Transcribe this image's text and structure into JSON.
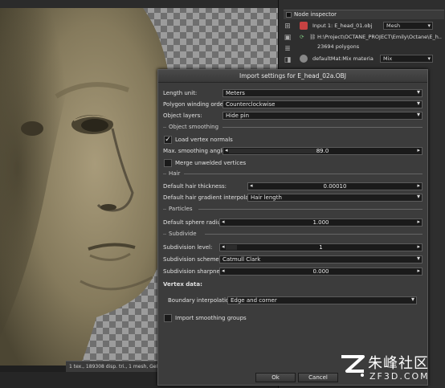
{
  "node_inspector": {
    "title": "Node inspector",
    "input_label": "Input 1: E_head_01.obj",
    "input_type": "Mesh",
    "path": "H:\\Project\\OCTANE_PROJECT\\Emily\\Octane\\E_h...",
    "polygons": "23694 polygons",
    "material_label": "defaultMat:Mix materia",
    "material_value": "Mix"
  },
  "status_bar": {
    "text": "1 tex., 189308 disp. tri., 1 mesh, GeForce GT"
  },
  "dialog": {
    "title": "Import settings for E_head_02a.OBJ",
    "length_unit": {
      "label": "Length unit:",
      "value": "Meters"
    },
    "winding_order": {
      "label": "Polygon winding order:",
      "value": "Counterclockwise"
    },
    "object_layers": {
      "label": "Object layers:",
      "value": "Hide pin"
    },
    "object_smoothing": {
      "section": "Object smoothing",
      "load_vertex_normals": {
        "label": "Load vertex normals",
        "checked": true
      },
      "max_smoothing_angle": {
        "label": "Max. smoothing angle:",
        "value": "89.0",
        "fraction": 0.49
      },
      "merge_unwelded": {
        "label": "Merge unwelded vertices",
        "checked": false
      }
    },
    "hair": {
      "section": "Hair",
      "thickness": {
        "label": "Default hair thickness:",
        "value": "0.00010"
      },
      "gradient": {
        "label": "Default hair gradient interpolation:",
        "value": "Hair length"
      }
    },
    "particles": {
      "section": "Particles",
      "sphere_radius": {
        "label": "Default sphere radius:",
        "value": "1.000"
      }
    },
    "subdivide": {
      "section": "Subdivide",
      "level": {
        "label": "Subdivision level:",
        "value": "1",
        "fraction": 0.05
      },
      "scheme": {
        "label": "Subdivision scheme:",
        "value": "Catmull Clark"
      },
      "sharpness": {
        "label": "Subdivision sharpness:",
        "value": "0.000"
      }
    },
    "vertex_data": {
      "heading": "Vertex data:",
      "boundary": {
        "label": "Boundary interpolation:",
        "value": "Edge and corner"
      },
      "import_smoothing": {
        "label": "Import smoothing groups",
        "checked": false
      }
    },
    "ok_label": "Ok",
    "cancel_label": "Cancel"
  },
  "watermark": {
    "cn": "朱峰社区",
    "en": "ZF3D.COM"
  },
  "colors": {
    "dialog_bg": "#3c3c3c",
    "field_bg": "#1c1c1c",
    "skin": "#8a7f62",
    "material_icon": "#c74242"
  }
}
